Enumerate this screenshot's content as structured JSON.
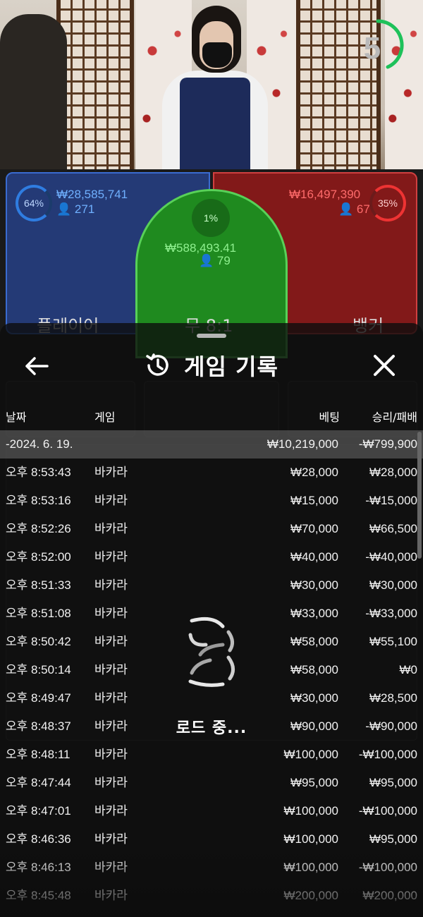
{
  "video": {
    "countdown": "5",
    "player": {
      "percent": "64%",
      "amount": "₩28,585,741",
      "players": "271",
      "label": "플레이어"
    },
    "tie": {
      "percent": "1%",
      "amount": "₩588,493.41",
      "players": "79",
      "label": "무 8:1"
    },
    "banker": {
      "percent": "35%",
      "amount": "₩16,497,390",
      "players": "67",
      "label": "뱅커"
    }
  },
  "panel": {
    "title": "게임 기록",
    "back_icon": "arrow-left-icon",
    "history_icon": "history-clock-icon",
    "close_icon": "close-x-icon",
    "columns": {
      "date": "날짜",
      "game": "게임",
      "bet": "베팅",
      "result": "승리/패배"
    },
    "group": {
      "date": "-2024. 6. 19.",
      "bet": "₩10,219,000",
      "result": "-₩799,900"
    },
    "rows": [
      {
        "time": "오후 8:53:43",
        "game": "바카라",
        "bet": "₩28,000",
        "result": "₩28,000"
      },
      {
        "time": "오후 8:53:16",
        "game": "바카라",
        "bet": "₩15,000",
        "result": "-₩15,000"
      },
      {
        "time": "오후 8:52:26",
        "game": "바카라",
        "bet": "₩70,000",
        "result": "₩66,500"
      },
      {
        "time": "오후 8:52:00",
        "game": "바카라",
        "bet": "₩40,000",
        "result": "-₩40,000"
      },
      {
        "time": "오후 8:51:33",
        "game": "바카라",
        "bet": "₩30,000",
        "result": "₩30,000"
      },
      {
        "time": "오후 8:51:08",
        "game": "바카라",
        "bet": "₩33,000",
        "result": "-₩33,000"
      },
      {
        "time": "오후 8:50:42",
        "game": "바카라",
        "bet": "₩58,000",
        "result": "₩55,100"
      },
      {
        "time": "오후 8:50:14",
        "game": "바카라",
        "bet": "₩58,000",
        "result": "₩0"
      },
      {
        "time": "오후 8:49:47",
        "game": "바카라",
        "bet": "₩30,000",
        "result": "₩28,500"
      },
      {
        "time": "오후 8:48:37",
        "game": "바카라",
        "bet": "₩90,000",
        "result": "-₩90,000"
      },
      {
        "time": "오후 8:48:11",
        "game": "바카라",
        "bet": "₩100,000",
        "result": "-₩100,000"
      },
      {
        "time": "오후 8:47:44",
        "game": "바카라",
        "bet": "₩95,000",
        "result": "₩95,000"
      },
      {
        "time": "오후 8:47:01",
        "game": "바카라",
        "bet": "₩100,000",
        "result": "-₩100,000"
      },
      {
        "time": "오후 8:46:36",
        "game": "바카라",
        "bet": "₩100,000",
        "result": "₩95,000"
      },
      {
        "time": "오후 8:46:13",
        "game": "바카라",
        "bet": "₩100,000",
        "result": "-₩100,000"
      },
      {
        "time": "오후 8:45:48",
        "game": "바카라",
        "bet": "₩200,000",
        "result": "₩200,000"
      }
    ],
    "loading_text": "로드 중..."
  }
}
